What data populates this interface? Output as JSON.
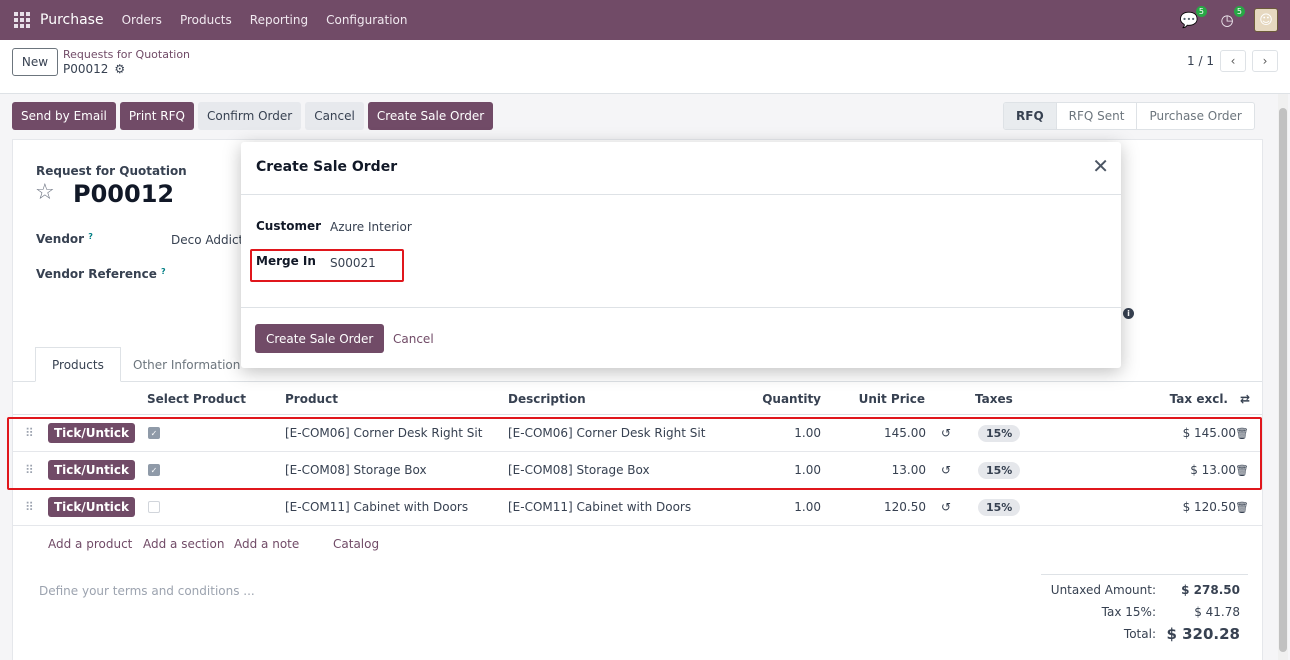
{
  "nav": {
    "brand": "Purchase",
    "menu": [
      "Orders",
      "Products",
      "Reporting",
      "Configuration"
    ],
    "chat_badge": "5",
    "activity_badge": "5"
  },
  "control": {
    "new_label": "New",
    "breadcrumb": "Requests for Quotation",
    "record": "P00012",
    "pager": "1 / 1"
  },
  "buttons": [
    "Send by Email",
    "Print RFQ",
    "Confirm Order",
    "Cancel",
    "Create Sale Order"
  ],
  "status": {
    "stages": [
      "RFQ",
      "RFQ Sent",
      "Purchase Order"
    ],
    "active": "RFQ"
  },
  "form": {
    "type_label": "Request for Quotation",
    "name": "P00012",
    "vendor_label": "Vendor",
    "vendor_value": "Deco Addict",
    "vendor_ref_label": "Vendor Reference",
    "help_mark": "?"
  },
  "tabs": [
    "Products",
    "Other Information"
  ],
  "table": {
    "headers": {
      "select": "Select Product",
      "product": "Product",
      "description": "Description",
      "quantity": "Quantity",
      "unit_price": "Unit Price",
      "taxes": "Taxes",
      "tax_excl": "Tax excl."
    },
    "rows": [
      {
        "tick": "Tick/Untick",
        "product": "[E-COM06] Corner Desk Right Sit",
        "description": "[E-COM06] Corner Desk Right Sit",
        "quantity": "1.00",
        "unit_price": "145.00",
        "tax": "15%",
        "subtotal": "$ 145.00"
      },
      {
        "tick": "Tick/Untick",
        "product": "[E-COM08] Storage Box",
        "description": "[E-COM08] Storage Box",
        "quantity": "1.00",
        "unit_price": "13.00",
        "tax": "15%",
        "subtotal": "$ 13.00"
      },
      {
        "tick": "Tick/Untick",
        "product": "[E-COM11] Cabinet with Doors",
        "description": "[E-COM11] Cabinet with Doors",
        "quantity": "1.00",
        "unit_price": "120.50",
        "tax": "15%",
        "subtotal": "$ 120.50"
      }
    ],
    "add_links": [
      "Add a product",
      "Add a section",
      "Add a note",
      "Catalog"
    ]
  },
  "terms_placeholder": "Define your terms and conditions ...",
  "totals": {
    "untaxed_label": "Untaxed Amount:",
    "untaxed_value": "$ 278.50",
    "tax_label": "Tax 15%:",
    "tax_value": "$ 41.78",
    "total_label": "Total:",
    "total_value": "$ 320.28"
  },
  "modal": {
    "title": "Create Sale Order",
    "customer_label": "Customer",
    "customer_value": "Azure Interior",
    "merge_label": "Merge In",
    "merge_value": "S00021",
    "confirm_label": "Create Sale Order",
    "cancel_label": "Cancel"
  },
  "colors": {
    "brand": "#714b67",
    "highlight": "#e0161c"
  }
}
